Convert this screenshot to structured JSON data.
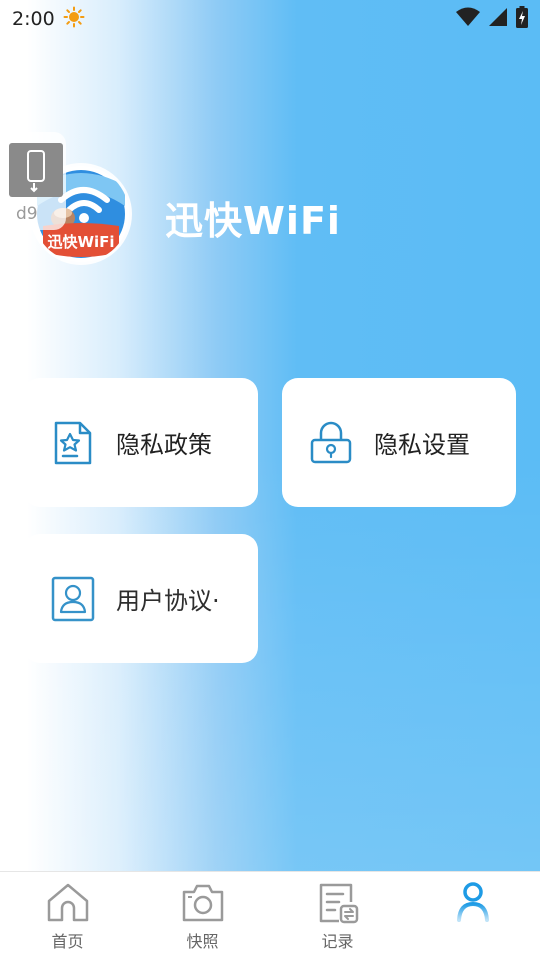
{
  "status_bar": {
    "time": "2:00",
    "icons": [
      "sun-notification-icon",
      "wifi-icon",
      "signal-icon",
      "battery-charging-icon"
    ]
  },
  "floating_helper": {
    "code": "d9",
    "icon": "phone-tap-icon"
  },
  "app": {
    "logo_text": "迅快WiFi",
    "title": "迅快WiFi"
  },
  "cards": {
    "privacy_policy": {
      "label": "隐私政策",
      "icon": "star-document-icon"
    },
    "privacy_settings": {
      "label": "隐私设置",
      "icon": "lock-icon"
    },
    "user_agreement": {
      "label": "用户协议·",
      "icon": "person-icon"
    }
  },
  "bottom_nav": {
    "items": [
      {
        "label": "首页",
        "icon": "home-icon",
        "active": false
      },
      {
        "label": "快照",
        "icon": "camera-icon",
        "active": false
      },
      {
        "label": "记录",
        "icon": "record-icon",
        "active": false
      },
      {
        "label": "",
        "icon": "user-icon",
        "active": true
      }
    ]
  },
  "colors": {
    "accent": "#1e9be5",
    "background_blue": "#5bbcf5",
    "card_background": "#ffffff",
    "icon_blue": "#2a8cc6"
  }
}
